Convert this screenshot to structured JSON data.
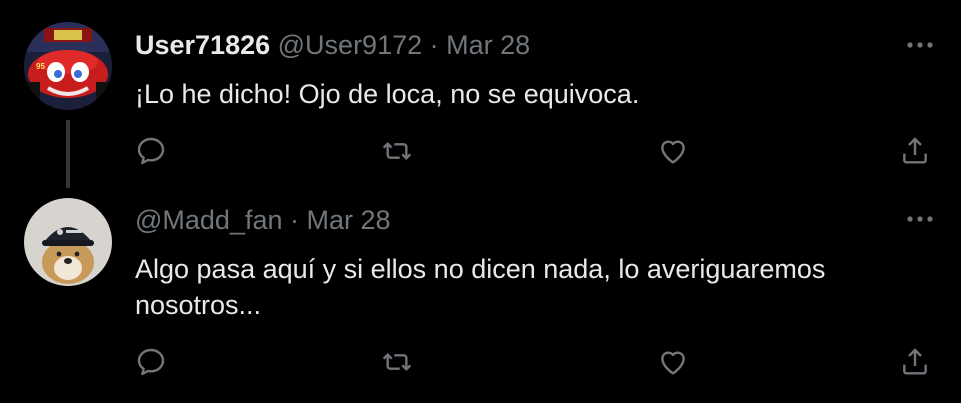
{
  "colors": {
    "background": "#000000",
    "primary_text": "#e7e9ea",
    "secondary_text": "#71767b",
    "thread_line": "#333639"
  },
  "tweets": [
    {
      "display_name": "User71826",
      "handle": "@User9172",
      "separator": "·",
      "date": "Mar 28",
      "text": "¡Lo he dicho! Ojo de loca, no se equivoca.",
      "avatar_icon": "race-car-avatar",
      "actions": [
        "reply-icon",
        "retweet-icon",
        "like-icon",
        "share-icon"
      ]
    },
    {
      "display_name": "",
      "handle": "@Madd_fan",
      "separator": "·",
      "date": "Mar 28",
      "text": "Algo pasa aquí y si ellos no dicen nada, lo averiguaremos nosotros...",
      "avatar_icon": "dog-with-cap-avatar",
      "actions": [
        "reply-icon",
        "retweet-icon",
        "like-icon",
        "share-icon"
      ]
    }
  ]
}
